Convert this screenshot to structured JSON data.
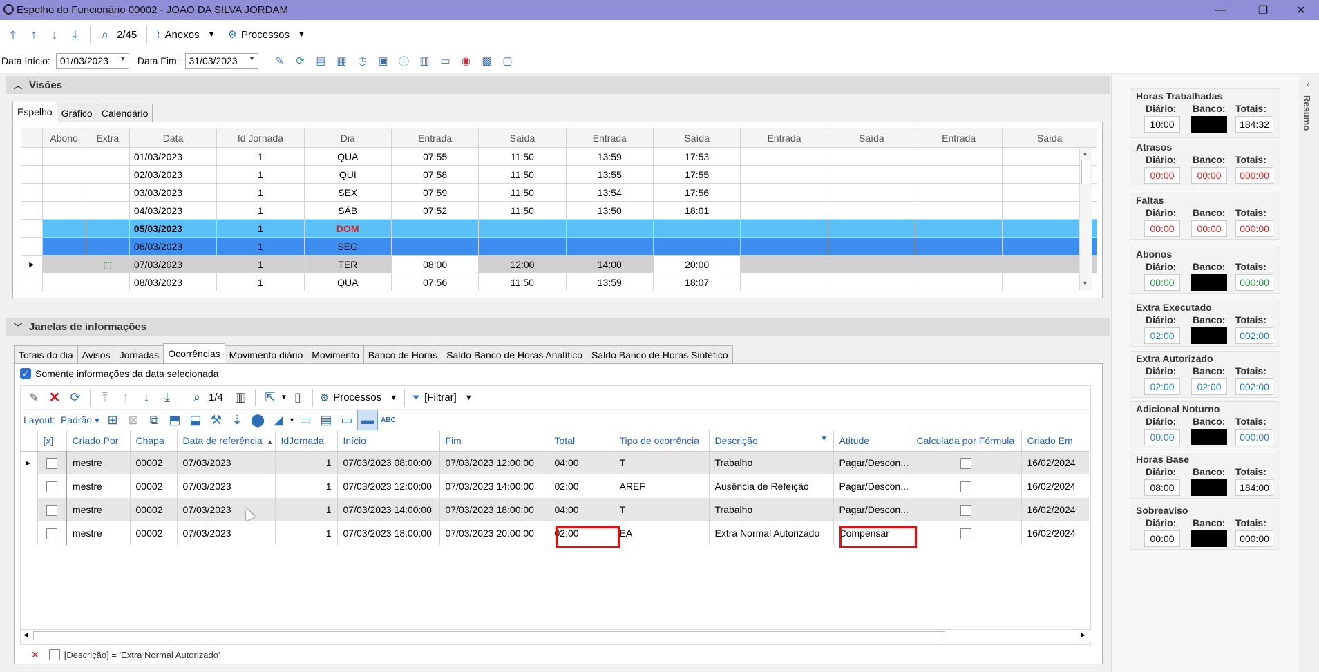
{
  "window": {
    "title": "Espelho do Funcionário 00002 - JOAO DA SILVA JORDAM",
    "min": "—",
    "max": "❐",
    "close": "✕"
  },
  "toolbar": {
    "counter": "2/45",
    "anexos": "Anexos",
    "processos": "Processos"
  },
  "filters": {
    "data_inicio_label": "Data Início:",
    "data_inicio": "01/03/2023",
    "data_fim_label": "Data Fim:",
    "data_fim": "31/03/2023"
  },
  "visoes": {
    "title": "Visões",
    "tabs": [
      "Espelho",
      "Gráfico",
      "Calendário"
    ],
    "columns": [
      "Abono",
      "Extra",
      "Data",
      "Id Jornada",
      "Dia",
      "Entrada",
      "Saída",
      "Entrada",
      "Saída",
      "Entrada",
      "Saída",
      "Entrada",
      "Saída"
    ],
    "rows": [
      {
        "data": "01/03/2023",
        "id": "1",
        "dia": "QUA",
        "t": [
          "07:55",
          "11:50",
          "13:59",
          "17:53"
        ]
      },
      {
        "data": "02/03/2023",
        "id": "1",
        "dia": "QUI",
        "t": [
          "07:58",
          "11:50",
          "13:55",
          "17:55"
        ]
      },
      {
        "data": "03/03/2023",
        "id": "1",
        "dia": "SEX",
        "t": [
          "07:59",
          "11:50",
          "13:54",
          "17:56"
        ]
      },
      {
        "data": "04/03/2023",
        "id": "1",
        "dia": "SÁB",
        "t": [
          "07:52",
          "11:50",
          "13:50",
          "18:01"
        ]
      },
      {
        "data": "05/03/2023",
        "id": "1",
        "dia": "DOM",
        "t": [
          "",
          "",
          "",
          ""
        ]
      },
      {
        "data": "06/03/2023",
        "id": "1",
        "dia": "SEG",
        "t": [
          "",
          "",
          "",
          ""
        ]
      },
      {
        "data": "07/03/2023",
        "id": "1",
        "dia": "TER",
        "t": [
          "08:00",
          "12:00",
          "14:00",
          "20:00"
        ]
      },
      {
        "data": "08/03/2023",
        "id": "1",
        "dia": "QUA",
        "t": [
          "07:56",
          "11:50",
          "13:59",
          "18:07"
        ]
      }
    ]
  },
  "janelas": {
    "title": "Janelas de informações",
    "tabs": [
      "Totais do dia",
      "Avisos",
      "Jornadas",
      "Ocorrências",
      "Movimento diário",
      "Movimento",
      "Banco de Horas",
      "Saldo Banco de Horas Analítico",
      "Saldo Banco de Horas Sintético"
    ],
    "somente": "Somente informações da data selecionada",
    "pager": "1/4",
    "processos": "Processos",
    "filtrar": "[Filtrar]",
    "layout_label": "Layout:",
    "layout_value": "Padrão",
    "columns": [
      "[x]",
      "Criado Por",
      "Chapa",
      "Data de referência",
      "IdJornada",
      "Início",
      "Fim",
      "Total",
      "Tipo de ocorrência",
      "Descrição",
      "Atitude",
      "Calculada por Fórmula",
      "Criado Em"
    ],
    "rows": [
      {
        "criado": "mestre",
        "chapa": "00002",
        "ref": "07/03/2023",
        "idj": "1",
        "ini": "07/03/2023 08:00:00",
        "fim": "07/03/2023 12:00:00",
        "total": "04:00",
        "tipo": "T",
        "desc": "Trabalho",
        "atitude": "Pagar/Descon...",
        "em": "16/02/2024"
      },
      {
        "criado": "mestre",
        "chapa": "00002",
        "ref": "07/03/2023",
        "idj": "1",
        "ini": "07/03/2023 12:00:00",
        "fim": "07/03/2023 14:00:00",
        "total": "02:00",
        "tipo": "AREF",
        "desc": "Ausência de Refeição",
        "atitude": "Pagar/Descon...",
        "em": "16/02/2024"
      },
      {
        "criado": "mestre",
        "chapa": "00002",
        "ref": "07/03/2023",
        "idj": "1",
        "ini": "07/03/2023 14:00:00",
        "fim": "07/03/2023 18:00:00",
        "total": "04:00",
        "tipo": "T",
        "desc": "Trabalho",
        "atitude": "Pagar/Descon...",
        "em": "16/02/2024"
      },
      {
        "criado": "mestre",
        "chapa": "00002",
        "ref": "07/03/2023",
        "idj": "1",
        "ini": "07/03/2023 18:00:00",
        "fim": "07/03/2023 20:00:00",
        "total": "02:00",
        "tipo": "EA",
        "desc": "Extra Normal Autorizado",
        "atitude": "Compensar",
        "em": "16/02/2024"
      }
    ],
    "filter_text": "[Descrição] = 'Extra Normal Autorizado'"
  },
  "resumo": {
    "label": "Resumo",
    "cards": [
      {
        "title": "Horas Trabalhadas",
        "diario": "10:00",
        "banco": "",
        "totais": "184:32",
        "color": "#000000"
      },
      {
        "title": "Atrasos",
        "diario": "00:00",
        "banco": "00:00",
        "totais": "000:00",
        "color": "#e02020"
      },
      {
        "title": "Faltas",
        "diario": "00:00",
        "banco": "00:00",
        "totais": "000:00",
        "color": "#e02020"
      },
      {
        "title": "Abonos",
        "diario": "00:00",
        "banco": "",
        "totais": "000:00",
        "color": "#1f9b3a"
      },
      {
        "title": "Extra Executado",
        "diario": "02:00",
        "banco": "",
        "totais": "002:00",
        "color": "#2a7cd0"
      },
      {
        "title": "Extra Autorizado",
        "diario": "02:00",
        "banco": "02:00",
        "totais": "002:00",
        "color": "#2a7cd0"
      },
      {
        "title": "Adicional Noturno",
        "diario": "00:00",
        "banco": "",
        "totais": "000:00",
        "color": "#2a7cd0"
      },
      {
        "title": "Horas Base",
        "diario": "08:00",
        "banco": "",
        "totais": "184:00",
        "color": "#000000"
      },
      {
        "title": "Sobreaviso",
        "diario": "00:00",
        "banco": "",
        "totais": "000:00",
        "color": "#000000"
      }
    ],
    "lbl_diario": "Diário:",
    "lbl_banco": "Banco:",
    "lbl_totais": "Totais:"
  }
}
